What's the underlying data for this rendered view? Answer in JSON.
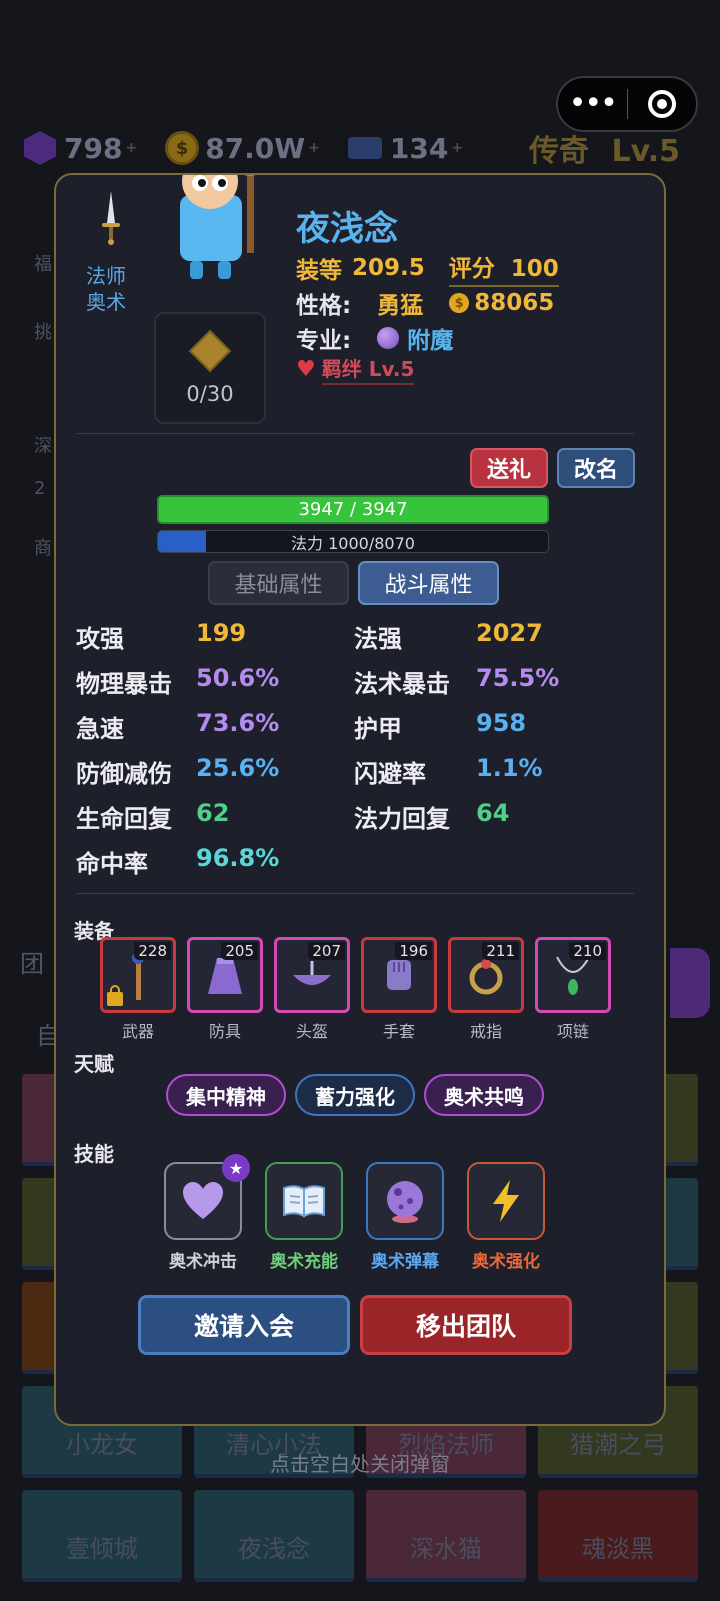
{
  "topbar": {
    "gems": "798",
    "gold": "87.0W",
    "tickets": "134",
    "plus": "+",
    "rank_label": "传奇",
    "rank_level": "Lv.5"
  },
  "background": {
    "side_items": [
      "福",
      "挑",
      "深",
      "商"
    ],
    "side_badge": "2",
    "tabs": [
      "团",
      "自"
    ],
    "grid_cells": [
      "",
      "",
      "",
      "",
      "",
      "",
      "",
      "",
      "",
      "",
      "",
      "",
      "小龙女",
      "清心小法",
      "烈焰法师",
      "猎潮之弓",
      "壹倾城",
      "夜浅念",
      "深水猫",
      "魂淡黑"
    ],
    "close_hint": "点击空白处关闭弹窗"
  },
  "hero": {
    "class_line1": "法师",
    "class_line2": "奥术",
    "token_count": "0/30",
    "name": "夜浅念",
    "gear_label": "装等",
    "gear_value": "209.5",
    "score_label": "评分",
    "score_value": "100",
    "personality_label": "性格:",
    "personality_value": "勇猛",
    "coin_value": "88065",
    "profession_label": "专业:",
    "profession_value": "附魔",
    "bond_label": "羁绊 Lv.5"
  },
  "actions": {
    "gift": "送礼",
    "rename": "改名",
    "invite": "邀请入会",
    "remove": "移出团队"
  },
  "bars": {
    "hp_text": "3947 / 3947",
    "hp_fraction": 1.0,
    "mp_text": "法力 1000/8070",
    "mp_fraction": 0.124
  },
  "tabs": {
    "basic": "基础属性",
    "combat": "战斗属性",
    "active": "combat"
  },
  "stats": [
    {
      "label": "攻强",
      "value": "199",
      "color": "#f0b83a"
    },
    {
      "label": "法强",
      "value": "2027",
      "color": "#f0b83a"
    },
    {
      "label": "物理暴击",
      "value": "50.6%",
      "color": "#b48cf0"
    },
    {
      "label": "法术暴击",
      "value": "75.5%",
      "color": "#b48cf0"
    },
    {
      "label": "急速",
      "value": "73.6%",
      "color": "#b48cf0"
    },
    {
      "label": "护甲",
      "value": "958",
      "color": "#5ab0f0"
    },
    {
      "label": "防御减伤",
      "value": "25.6%",
      "color": "#5ab0f0"
    },
    {
      "label": "闪避率",
      "value": "1.1%",
      "color": "#5ab0f0"
    },
    {
      "label": "生命回复",
      "value": "62",
      "color": "#4ed08a"
    },
    {
      "label": "法力回复",
      "value": "64",
      "color": "#4ed08a"
    },
    {
      "label": "命中率",
      "value": "96.8%",
      "color": "#5ad8d8"
    }
  ],
  "equipment_title": "装备",
  "equipment": [
    {
      "name": "武器",
      "level": "228",
      "icon": "staff-icon",
      "rarity": "red"
    },
    {
      "name": "防具",
      "level": "205",
      "icon": "robe-icon",
      "rarity": "pink"
    },
    {
      "name": "头盔",
      "level": "207",
      "icon": "hat-icon",
      "rarity": "pink"
    },
    {
      "name": "手套",
      "level": "196",
      "icon": "glove-icon",
      "rarity": "red"
    },
    {
      "name": "戒指",
      "level": "211",
      "icon": "ring-icon",
      "rarity": "red"
    },
    {
      "name": "项链",
      "level": "210",
      "icon": "necklace-icon",
      "rarity": "pink"
    }
  ],
  "talents_title": "天赋",
  "talents": [
    "集中精神",
    "蓄力强化",
    "奥术共鸣"
  ],
  "skills_title": "技能",
  "skills": [
    {
      "name": "奥术冲击",
      "icon": "heart-icon",
      "color": "#d0d2da"
    },
    {
      "name": "奥术充能",
      "icon": "book-icon",
      "color": "#6ed07a"
    },
    {
      "name": "奥术弹幕",
      "icon": "crystal-ball-icon",
      "color": "#5aa8f0"
    },
    {
      "name": "奥术强化",
      "icon": "lightning-icon",
      "color": "#e8683a"
    }
  ]
}
